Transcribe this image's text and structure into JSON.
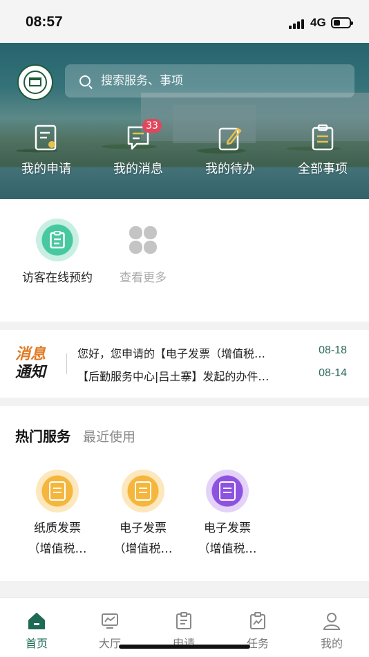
{
  "status_bar": {
    "time": "08:57",
    "network": "4G"
  },
  "header": {
    "search_placeholder": "搜索服务、事项",
    "quick_actions": [
      {
        "label": "我的申请",
        "icon": "application-form-icon"
      },
      {
        "label": "我的消息",
        "icon": "message-icon",
        "badge": "33"
      },
      {
        "label": "我的待办",
        "icon": "todo-edit-icon"
      },
      {
        "label": "全部事项",
        "icon": "clipboard-list-icon"
      }
    ]
  },
  "services": [
    {
      "label": "访客在线预约",
      "icon": "visitor-appointment-icon",
      "color": "#47c8a0"
    },
    {
      "label": "查看更多",
      "icon": "four-leaf-more-icon",
      "color": "#c4c4c4"
    }
  ],
  "notice": {
    "brand_line1": "消息",
    "brand_line2": "通知",
    "items": [
      {
        "text": "您好，您申请的【电子发票（增值税…",
        "date": "08-18"
      },
      {
        "text": "【后勤服务中心|吕土寨】发起的办件…",
        "date": "08-14"
      }
    ]
  },
  "hot_services": {
    "title": "热门服务",
    "subtitle": "最近使用",
    "items": [
      {
        "line1": "纸质发票",
        "line2": "（增值税…",
        "icon": "paper-invoice-icon",
        "color": "#f5b63d"
      },
      {
        "line1": "电子发票",
        "line2": "（增值税…",
        "icon": "e-invoice-icon",
        "color": "#f5b63d"
      },
      {
        "line1": "电子发票",
        "line2": "（增值税…",
        "icon": "e-invoice-edit-icon",
        "color": "#8e52e0"
      }
    ]
  },
  "tabbar": {
    "active": "首页",
    "items": [
      {
        "label": "首页",
        "icon": "home-icon"
      },
      {
        "label": "大厅",
        "icon": "hall-chart-icon"
      },
      {
        "label": "申请",
        "icon": "apply-doc-icon"
      },
      {
        "label": "任务",
        "icon": "task-chart-icon"
      },
      {
        "label": "我的",
        "icon": "profile-icon"
      }
    ]
  },
  "colors": {
    "primary": "#1e6a55",
    "badge": "#e0475b",
    "notice_accent": "#e07b24"
  }
}
